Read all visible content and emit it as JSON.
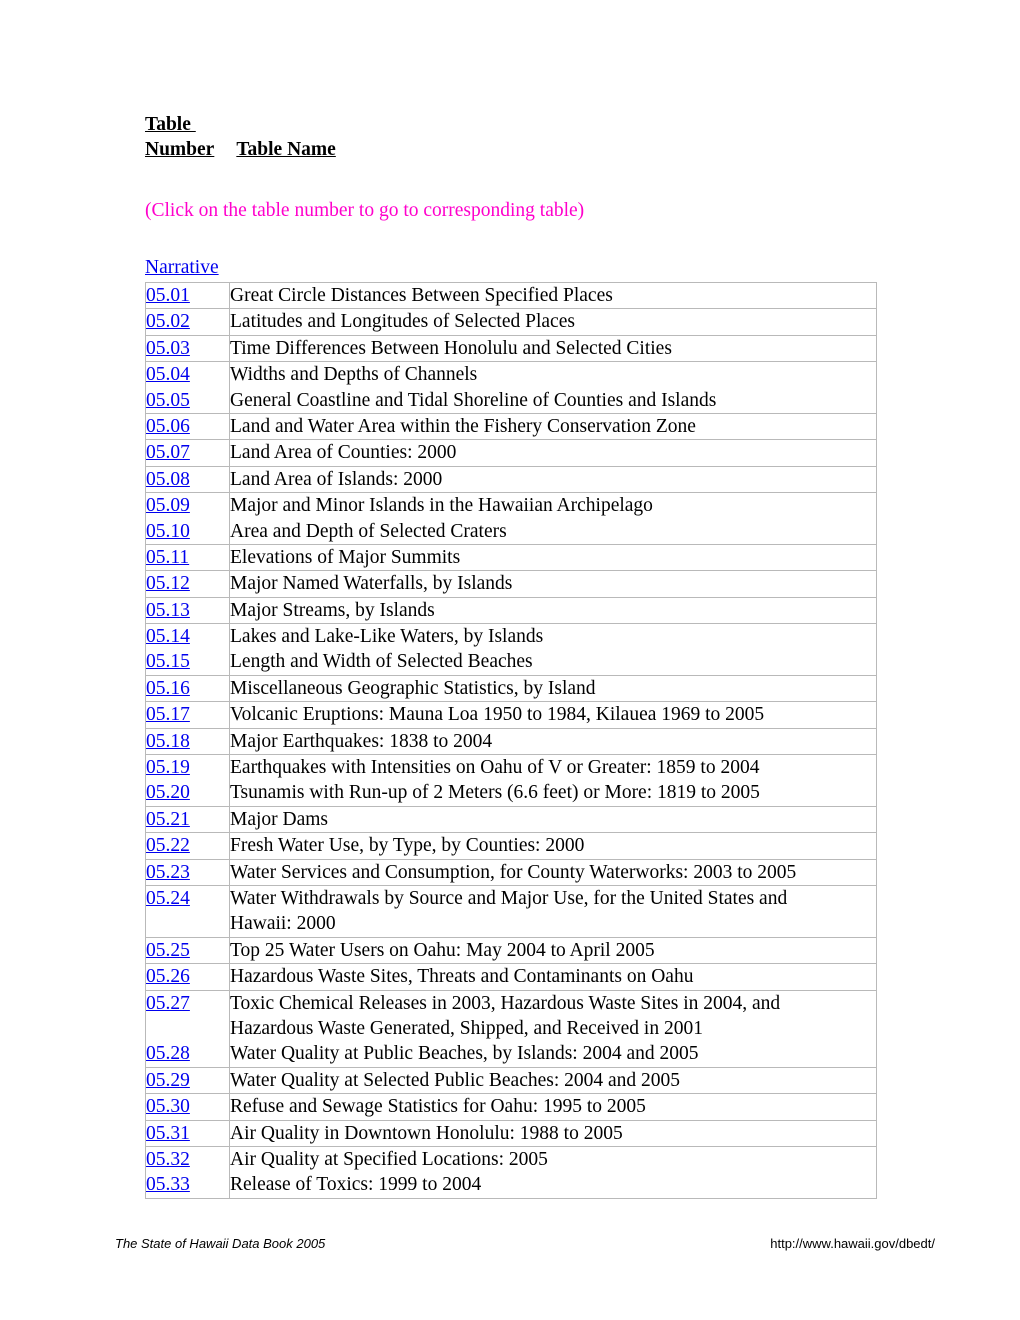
{
  "header": {
    "line1": "Table ",
    "line2_col1": "Number",
    "line2_col2": "Table Name"
  },
  "instruction": "(Click on the table number to go to corresponding table)",
  "narrative_link": "Narrative",
  "table": {
    "bands": [
      {
        "rows": [
          {
            "number": "05.01",
            "name": "Great Circle Distances Between Specified Places"
          }
        ]
      },
      {
        "rows": [
          {
            "number": "05.02",
            "name": "Latitudes and Longitudes of Selected Places"
          }
        ]
      },
      {
        "rows": [
          {
            "number": "05.03",
            "name": "Time Differences Between Honolulu and Selected Cities"
          }
        ]
      },
      {
        "rows": [
          {
            "number": "05.04",
            "name": "Widths and Depths of Channels"
          },
          {
            "number": "05.05",
            "name": "General Coastline and Tidal Shoreline of Counties and Islands"
          }
        ]
      },
      {
        "rows": [
          {
            "number": "05.06",
            "name": "Land and Water Area within the Fishery Conservation Zone"
          }
        ]
      },
      {
        "rows": [
          {
            "number": "05.07",
            "name": "Land Area of Counties: 2000"
          }
        ]
      },
      {
        "rows": [
          {
            "number": "05.08",
            "name": "Land Area of Islands: 2000"
          }
        ]
      },
      {
        "rows": [
          {
            "number": "05.09",
            "name": "Major and Minor Islands in the Hawaiian Archipelago"
          },
          {
            "number": "05.10",
            "name": "Area and Depth of Selected Craters"
          }
        ]
      },
      {
        "rows": [
          {
            "number": "05.11",
            "name": "Elevations of Major Summits"
          }
        ]
      },
      {
        "rows": [
          {
            "number": "05.12",
            "name": "Major Named Waterfalls, by Islands"
          }
        ]
      },
      {
        "rows": [
          {
            "number": "05.13",
            "name": "Major Streams, by Islands"
          }
        ]
      },
      {
        "rows": [
          {
            "number": "05.14",
            "name": "Lakes and Lake-Like Waters, by Islands"
          },
          {
            "number": "05.15",
            "name": "Length and Width of Selected Beaches"
          }
        ]
      },
      {
        "rows": [
          {
            "number": "05.16",
            "name": "Miscellaneous Geographic Statistics, by Island"
          }
        ]
      },
      {
        "rows": [
          {
            "number": "05.17",
            "name": "Volcanic Eruptions: Mauna Loa 1950 to 1984, Kilauea 1969 to 2005"
          }
        ]
      },
      {
        "rows": [
          {
            "number": "05.18",
            "name": "Major Earthquakes: 1838 to 2004"
          }
        ]
      },
      {
        "rows": [
          {
            "number": "05.19",
            "name": "Earthquakes with Intensities on Oahu of V or Greater: 1859 to 2004"
          },
          {
            "number": "05.20",
            "name": "Tsunamis with Run-up of 2 Meters (6.6 feet) or More: 1819 to 2005"
          }
        ]
      },
      {
        "rows": [
          {
            "number": "05.21",
            "name": "Major Dams"
          }
        ]
      },
      {
        "rows": [
          {
            "number": "05.22",
            "name": "Fresh Water Use, by Type, by Counties: 2000"
          }
        ]
      },
      {
        "rows": [
          {
            "number": "05.23",
            "name": "Water Services and Consumption, for County Waterworks: 2003 to 2005"
          }
        ]
      },
      {
        "rows": [
          {
            "number": "05.24",
            "name": "Water Withdrawals by Source and Major Use, for the United States and",
            "name_line2": "Hawaii: 2000"
          }
        ]
      },
      {
        "rows": [
          {
            "number": "05.25",
            "name": "Top 25 Water Users on Oahu: May 2004 to April 2005"
          }
        ]
      },
      {
        "rows": [
          {
            "number": "05.26",
            "name": "Hazardous Waste Sites, Threats and Contaminants on Oahu"
          }
        ]
      },
      {
        "rows": [
          {
            "number": "05.27",
            "name": "Toxic Chemical Releases in 2003, Hazardous Waste Sites in 2004, and",
            "name_line2": "Hazardous Waste Generated, Shipped, and Received in 2001"
          },
          {
            "number": "05.28",
            "name": "Water Quality at Public Beaches, by Islands: 2004 and 2005"
          }
        ]
      },
      {
        "rows": [
          {
            "number": "05.29",
            "name": "Water Quality at Selected Public Beaches: 2004 and 2005"
          }
        ]
      },
      {
        "rows": [
          {
            "number": "05.30",
            "name": "Refuse and Sewage Statistics for Oahu: 1995 to 2005"
          }
        ]
      },
      {
        "rows": [
          {
            "number": "05.31",
            "name": "Air Quality in Downtown Honolulu: 1988 to 2005"
          }
        ]
      },
      {
        "rows": [
          {
            "number": "05.32",
            "name": "Air Quality at Specified Locations: 2005"
          },
          {
            "number": "05.33",
            "name": "Release of Toxics: 1999 to 2004"
          }
        ]
      }
    ]
  },
  "footer": {
    "left": "The State of Hawaii Data Book 2005",
    "right": "http://www.hawaii.gov/dbedt/"
  },
  "colors": {
    "link": "#0000ee",
    "instruction": "#ff00cc",
    "border": "#b9b9b9",
    "text": "#000000"
  }
}
